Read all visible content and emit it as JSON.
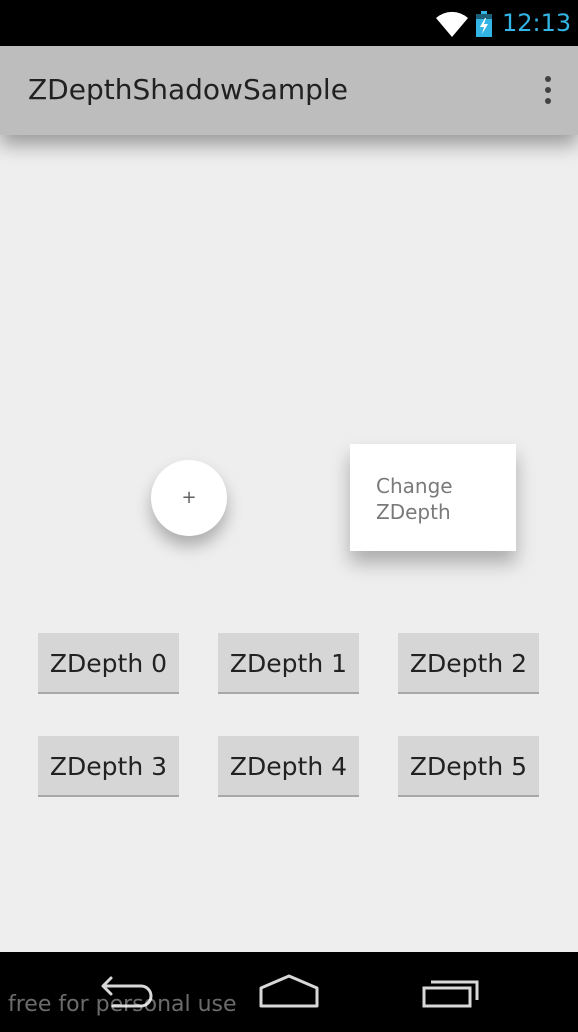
{
  "status_bar": {
    "time": "12:13",
    "icons": [
      "wifi-icon",
      "battery-charging-icon"
    ],
    "time_color": "#33b5e5"
  },
  "action_bar": {
    "title": "ZDepthShadowSample",
    "overflow_icon": "more-vert-icon",
    "background": "#bdbdbd"
  },
  "main": {
    "fab_label": "+",
    "card_label": "Change ZDepth",
    "buttons": [
      {
        "label": "ZDepth 0"
      },
      {
        "label": "ZDepth 1"
      },
      {
        "label": "ZDepth 2"
      },
      {
        "label": "ZDepth 3"
      },
      {
        "label": "ZDepth 4"
      },
      {
        "label": "ZDepth 5"
      }
    ]
  },
  "nav_bar": {
    "icons": [
      "back-icon",
      "home-icon",
      "recents-icon"
    ]
  },
  "watermark": "free for personal use"
}
